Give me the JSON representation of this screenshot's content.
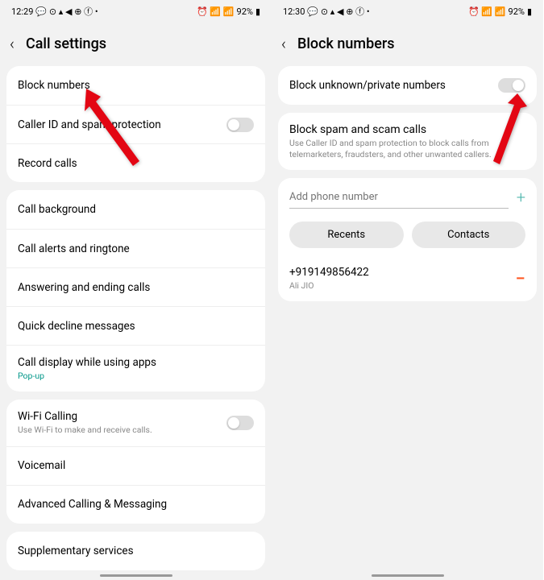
{
  "left": {
    "status": {
      "time": "12:29",
      "icons": "▬ ⊙ ▲ ◀ ⊕ ⓕ •",
      "right": "⏰ ⚙ 📶 92% ▮"
    },
    "battery": "92%",
    "title": "Call settings",
    "g1": [
      {
        "label": "Block numbers"
      },
      {
        "label": "Caller ID and spam protection",
        "toggle": true
      },
      {
        "label": "Record calls"
      }
    ],
    "g2": [
      {
        "label": "Call background"
      },
      {
        "label": "Call alerts and ringtone"
      },
      {
        "label": "Answering and ending calls"
      },
      {
        "label": "Quick decline messages"
      },
      {
        "label": "Call display while using apps",
        "sub": "Pop-up",
        "green": true
      }
    ],
    "g3": [
      {
        "label": "Wi-Fi Calling",
        "sub": "Use Wi-Fi to make and receive calls.",
        "toggle": true
      },
      {
        "label": "Voicemail"
      },
      {
        "label": "Advanced Calling & Messaging"
      }
    ],
    "g4": [
      {
        "label": "Supplementary services"
      }
    ]
  },
  "right": {
    "status": {
      "time": "12:30",
      "icons": "▬ ⊙ ▲ ◀ ⊕ ⓕ •",
      "right": "⏰ ⚙ 📶 92% ▮"
    },
    "battery": "92%",
    "title": "Block numbers",
    "toggle_label": "Block unknown/private numbers",
    "spam_title": "Block spam and scam calls",
    "spam_sub": "Use Caller ID and spam protection to block calls from telemarketers, fraudsters, and other unwanted callers.",
    "placeholder": "Add phone number",
    "recents": "Recents",
    "contacts": "Contacts",
    "num": "+919149856422",
    "num_sub": "Ali JIO"
  }
}
